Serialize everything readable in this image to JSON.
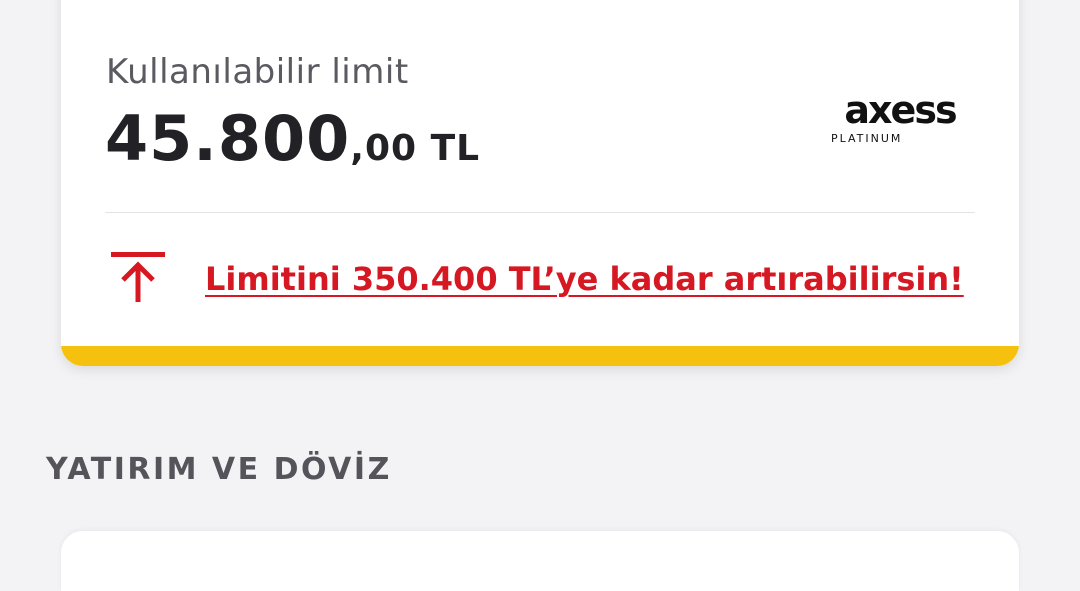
{
  "limit_card": {
    "label": "Kullanılabilir limit",
    "amount_main": "45.800",
    "amount_sub": ",00 TL",
    "brand": {
      "name": "axess",
      "tier": "PLATINUM"
    },
    "increase_link": "Limitini 350.400 TL’ye kadar artırabilirsin!",
    "increase_icon": "upload-arrow-icon",
    "accent_color": "#f6c10e",
    "link_color": "#d51822"
  },
  "section": {
    "title": "YATIRIM VE DÖVİZ"
  }
}
